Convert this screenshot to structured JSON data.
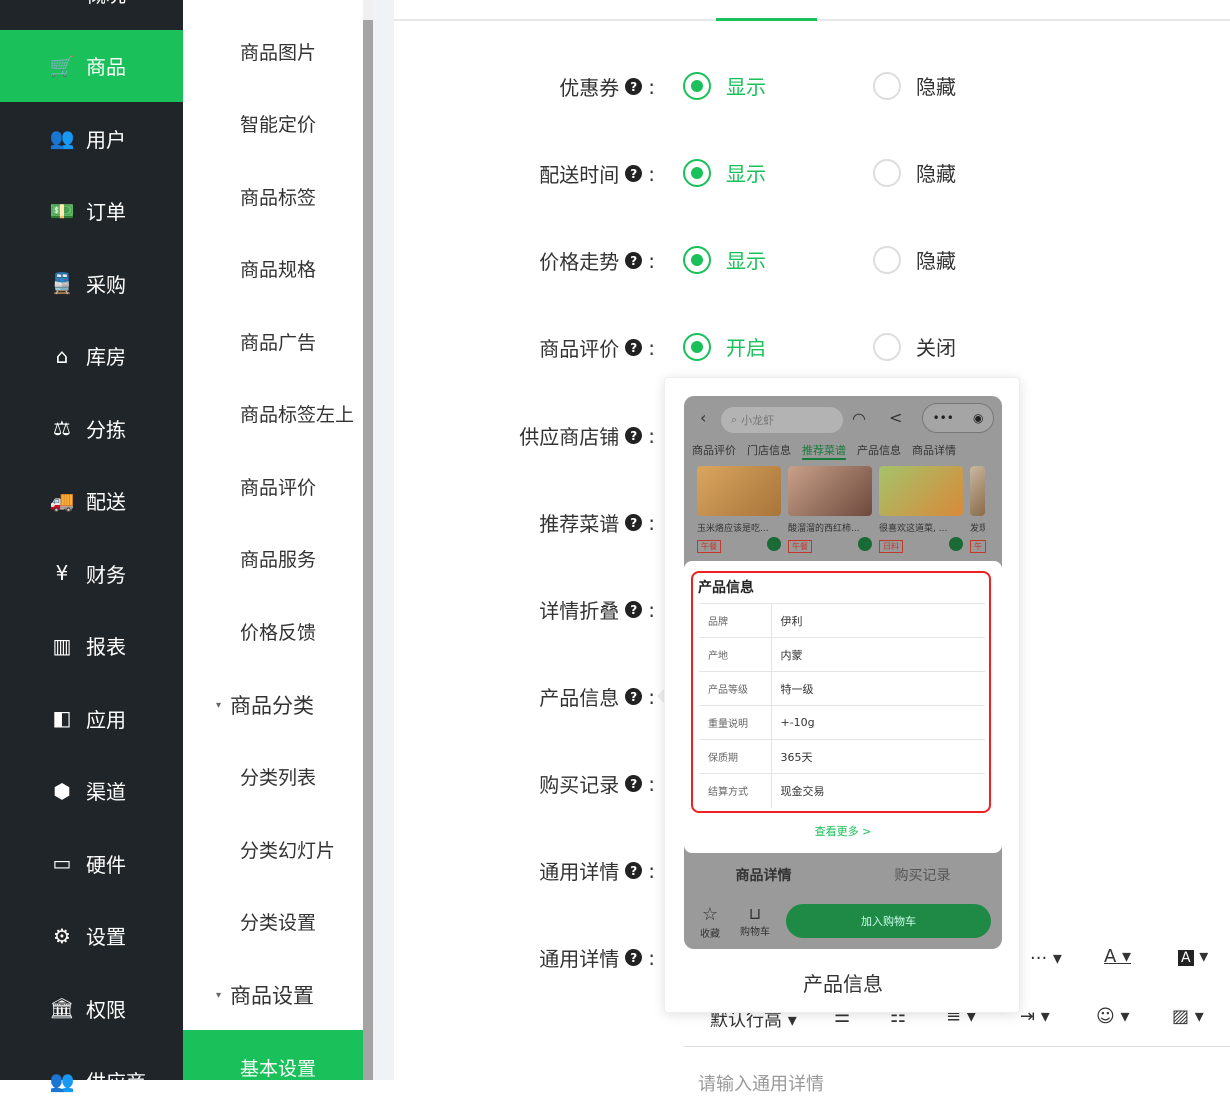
{
  "sidebar": {
    "items": [
      {
        "icon": "dashboard-icon",
        "glyph": "▭",
        "label": "概况"
      },
      {
        "icon": "cart-icon",
        "glyph": "🛒",
        "label": "商品"
      },
      {
        "icon": "users-icon",
        "glyph": "👥",
        "label": "用户"
      },
      {
        "icon": "money-icon",
        "glyph": "💵",
        "label": "订单"
      },
      {
        "icon": "train-icon",
        "glyph": "🚆",
        "label": "采购"
      },
      {
        "icon": "home-icon",
        "glyph": "⌂",
        "label": "库房"
      },
      {
        "icon": "scale-icon",
        "glyph": "⚖",
        "label": "分拣"
      },
      {
        "icon": "truck-icon",
        "glyph": "🚚",
        "label": "配送"
      },
      {
        "icon": "yen-icon",
        "glyph": "¥",
        "label": "财务"
      },
      {
        "icon": "bar-chart-icon",
        "glyph": "▥",
        "label": "报表"
      },
      {
        "icon": "apps-icon",
        "glyph": "◧",
        "label": "应用"
      },
      {
        "icon": "cube-icon",
        "glyph": "⬢",
        "label": "渠道"
      },
      {
        "icon": "monitor-icon",
        "glyph": "▭",
        "label": "硬件"
      },
      {
        "icon": "sitemap-icon",
        "glyph": "⚙",
        "label": "设置"
      },
      {
        "icon": "bank-icon",
        "glyph": "🏛",
        "label": "权限"
      },
      {
        "icon": "supplier-icon",
        "glyph": "👥",
        "label": "供应商"
      }
    ]
  },
  "submenu": {
    "items": [
      "商品图片",
      "智能定价",
      "商品标签",
      "商品规格",
      "商品广告",
      "商品标签左上",
      "商品评价",
      "商品服务",
      "价格反馈"
    ],
    "group1": "商品分类",
    "group1_items": [
      "分类列表",
      "分类幻灯片",
      "分类设置"
    ],
    "group2": "商品设置",
    "active": "基本设置"
  },
  "settings": {
    "rows": [
      {
        "label": "优惠券",
        "on": "显示",
        "off": "隐藏"
      },
      {
        "label": "配送时间",
        "on": "显示",
        "off": "隐藏"
      },
      {
        "label": "价格走势",
        "on": "显示",
        "off": "隐藏"
      },
      {
        "label": "商品评价",
        "on": "开启",
        "off": "关闭"
      },
      {
        "label": "供应商店铺"
      },
      {
        "label": "推荐菜谱"
      },
      {
        "label": "详情折叠"
      },
      {
        "label": "产品信息"
      },
      {
        "label": "购买记录"
      },
      {
        "label": "通用详情"
      },
      {
        "label": "通用详情"
      }
    ],
    "colon": ":"
  },
  "editor": {
    "line_height": "默认行高",
    "more": "···",
    "placeholder": "请输入通用详情"
  },
  "popover": {
    "caption": "产品信息",
    "phone": {
      "search": "小龙虾",
      "tabs": [
        "商品评价",
        "门店信息",
        "推荐菜谱",
        "产品信息",
        "商品详情"
      ],
      "active_tab": "推荐菜谱",
      "cards": [
        {
          "title": "玉米烙应该是吃...",
          "tag": "午餐"
        },
        {
          "title": "酸溜溜的西红柿...",
          "tag": "午餐"
        },
        {
          "title": "很喜欢这道菜, ...",
          "tag": "日料"
        },
        {
          "title": "发现",
          "tag": "午"
        }
      ],
      "info_title": "产品信息",
      "info_rows": [
        {
          "k": "品牌",
          "v": "伊利"
        },
        {
          "k": "产地",
          "v": "内蒙"
        },
        {
          "k": "产品等级",
          "v": "特一级"
        },
        {
          "k": "重量说明",
          "v": "+-10g"
        },
        {
          "k": "保质期",
          "v": "365天"
        },
        {
          "k": "结算方式",
          "v": "现金交易"
        }
      ],
      "more": "查看更多 >",
      "bottom_tabs": [
        "商品详情",
        "购买记录"
      ],
      "fav": "收藏",
      "cart": "购物车",
      "add_cart": "加入购物车"
    }
  },
  "colors": {
    "accent": "#1ac05a",
    "sidebar": "#1f2528",
    "highlight": "#e22222"
  }
}
